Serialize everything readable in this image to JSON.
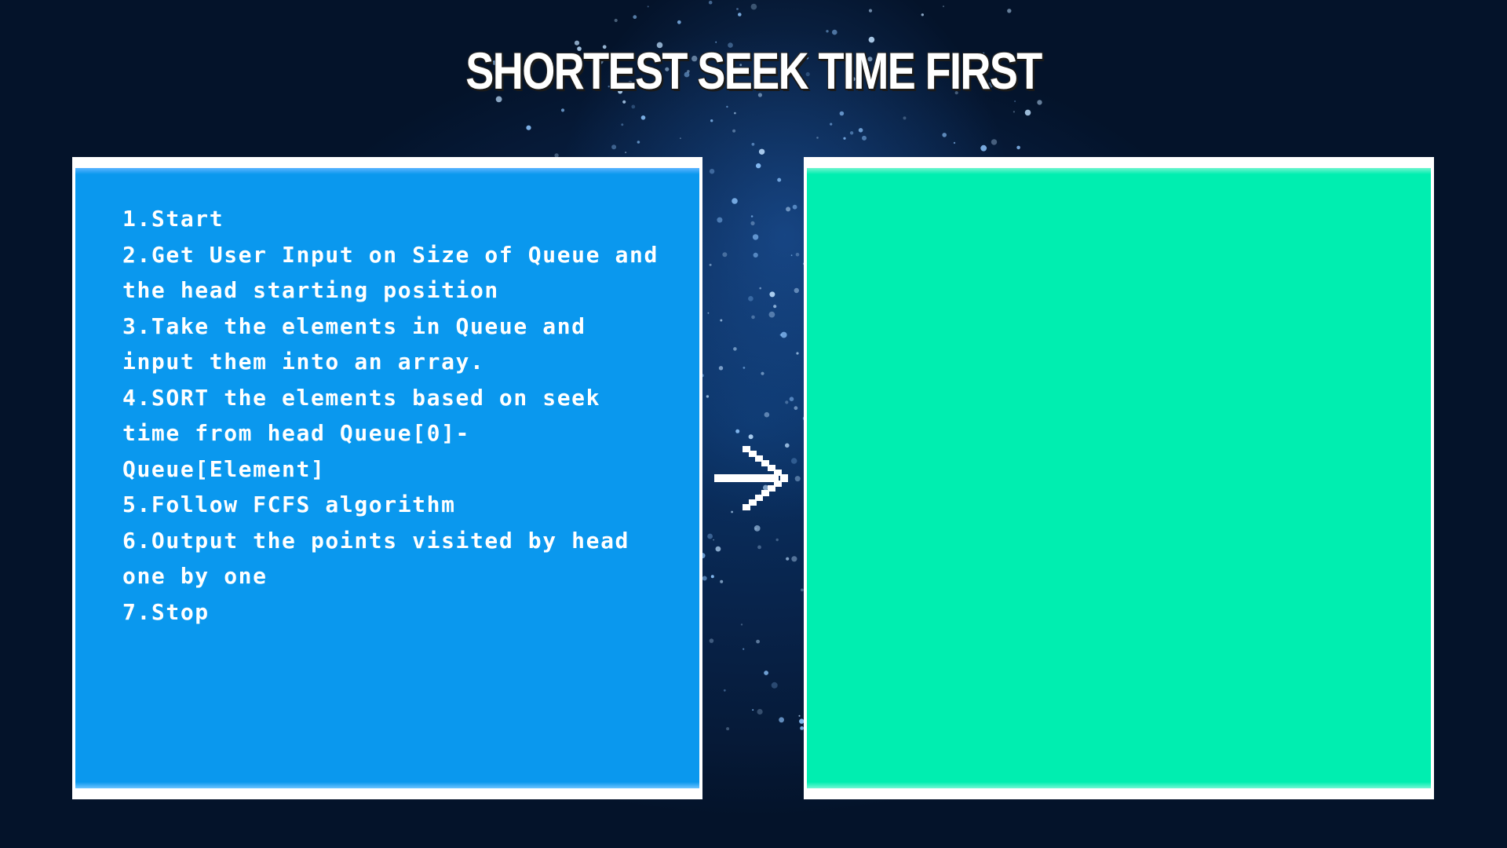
{
  "slide": {
    "title": "SHORTEST SEEK TIME FIRST",
    "background_color": "#08244c",
    "left_panel_color": "#0a98ee",
    "right_panel_color": "#00eeb0",
    "steps": [
      "1.Start",
      "2.Get User Input on Size of Queue and the head starting position",
      "3.Take the elements in Queue and input them into an array.",
      "4.SORT the elements based on seek time from head Queue[0]-Queue[Element]",
      "5.Follow FCFS algorithm",
      "6.Output the points visited by head one by one",
      "7.Stop"
    ],
    "arrow_icon": "arrow-right-icon"
  }
}
